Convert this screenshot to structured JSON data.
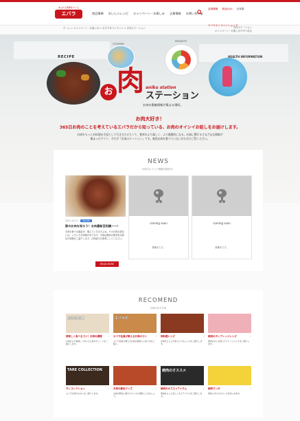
{
  "header": {
    "logo_tagline": "あふれる笑顔をつくる",
    "logo_text": "エバラ",
    "nav": [
      "商品情報",
      "おいしいレシピ",
      "キャンペーン・お楽しみ",
      "企業情報",
      "お問い合わせ"
    ],
    "util_top": [
      "会員情報",
      "商品Q&A",
      "日本語"
    ],
    "util_bottom": "エバラオンラインショップ"
  },
  "breadcrumb": "ホーム > キャンペーン・お楽しみ > おすすめコンテンツ > お肉ステーション",
  "subnav_right": [
    "お肉ステーション",
    "キャンペーン・お楽しみTOPへ戻る"
  ],
  "hero": {
    "recipe_label": "RECIPE",
    "cooking_label": "COOKING",
    "enquete_label": "ENQUETE",
    "health_label": "HEALTH INFORMATION",
    "o": "お",
    "niku": "肉",
    "aniku": "aniku station",
    "station": "ステーション",
    "tagline": "お肉の素敵情報が集まる場所。"
  },
  "lead": {
    "title": "お肉大好き！",
    "subtitle": "365日お肉のことを考えているエバラだから知っている、お肉のオイシイお話しをお届けします。",
    "body": "お肉をもっとお料理の主役として引き立たせたくて、食卓のより楽しく、より健康的になる。お肉に関するさまざまな情報が集まったサイト、それが「お肉ステーション」です。普段お肉を食べていない方もぜひご覧ください。"
  },
  "news": {
    "title": "NEWS",
    "subtitle": "お肉のオイシイ情報を発信中！",
    "featured": {
      "date": "2021.12.21",
      "badge": "RECIPE",
      "title": "豚のお肉を知ろう！お肉最新豆知識ーー！",
      "body": "お肉を食べる機会が、増えていきますよね。そのお肉の部位には、いろいろな特徴があります。今回は豚肉の基本的な部位の特徴をご紹介します。お肉選びの参考にしてください。",
      "button": "READ MORE"
    },
    "coming": [
      {
        "label": "coming soon",
        "note": "準備中です。"
      },
      {
        "label": "coming soon",
        "note": "準備中です。"
      }
    ]
  },
  "recommend": {
    "title": "RECOMEND",
    "subtitle": "お肉のおすすめ",
    "items": [
      {
        "caption": "お肉のお食",
        "title": "美味しく食べるコツ！お肉の調理",
        "desc": "お肉をより美味しく食べるためのポイントをご紹介します。",
        "color": "#e9dcc6"
      },
      {
        "caption": "エバラの",
        "title": "エバラ社員が教えるお肉のコツ",
        "desc": "エバラ社員が教えるお肉の美味しい食べ方をご紹介。",
        "color": "#c98a4a"
      },
      {
        "caption": "",
        "title": "肉料理レシピ",
        "desc": "お肉をたっぷり使った人気レシピをご紹介します。",
        "color": "#8a3a20"
      },
      {
        "caption": "",
        "title": "焼肉のタレアレンジレシピ",
        "desc": "焼肉のタレを使ったアレンジレシピをご紹介します。",
        "color": "#f0b0b8"
      },
      {
        "caption": "TARE COLLECTION",
        "title": "タレコレクション",
        "desc": "エバラの様々なタレをご紹介します。",
        "color": "#3c2a1e"
      },
      {
        "caption": "",
        "title": "お肉の部位クイズ",
        "desc": "お肉の部位に関するクイズに挑戦してみましょう。",
        "color": "#b84a2a"
      },
      {
        "caption": "焼肉のオススメ",
        "title": "焼肉のオススメアイテム",
        "desc": "焼肉をもっと楽しくするアイテムをご紹介します。",
        "color": "#2a2a2a"
      },
      {
        "caption": "",
        "title": "焼肉マンガ",
        "desc": "焼肉にまつわるマンガを楽しめます。",
        "color": "#f3d23a"
      }
    ]
  }
}
